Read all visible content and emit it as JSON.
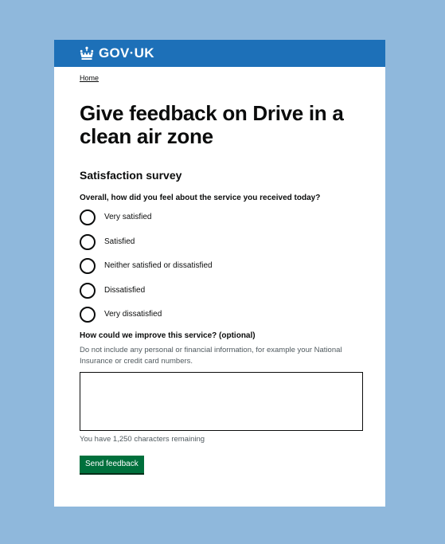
{
  "colors": {
    "background": "#8fb8dc",
    "header": "#1d70b8",
    "button": "#00703c",
    "hint_text": "#505a5f"
  },
  "header": {
    "logo_icon": "crown-icon",
    "logo_text": "GOV·UK"
  },
  "breadcrumb": {
    "home_label": "Home"
  },
  "page_title": "Give feedback on Drive in a clean air zone",
  "survey": {
    "heading": "Satisfaction survey",
    "question": "Overall, how did you feel about the service you received today?",
    "options": [
      {
        "label": "Very satisfied",
        "selected": false
      },
      {
        "label": "Satisfied",
        "selected": false
      },
      {
        "label": "Neither satisfied or dissatisfied",
        "selected": false
      },
      {
        "label": "Dissatisfied",
        "selected": false
      },
      {
        "label": "Very dissatisfied",
        "selected": false
      }
    ]
  },
  "improve": {
    "label": "How could we improve this service? (optional)",
    "hint": "Do not include any personal or financial information, for example your National Insurance or credit card numbers.",
    "value": "",
    "character_count": "You have 1,250 characters remaining"
  },
  "submit": {
    "label": "Send feedback"
  }
}
